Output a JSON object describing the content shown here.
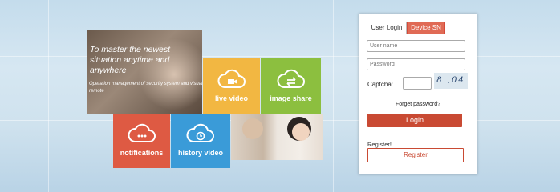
{
  "hero": {
    "title": "To master the newest situation anytime and anywhere",
    "subtitle": "Operation management of security system and visual remote"
  },
  "tiles": [
    {
      "label": "live video",
      "icon": "cloud-video-icon",
      "color": "#f2b742"
    },
    {
      "label": "image share",
      "icon": "cloud-share-icon",
      "color": "#8cbf3f"
    },
    {
      "label": "notifications",
      "icon": "cloud-chat-icon",
      "color": "#de5a43"
    },
    {
      "label": "history video",
      "icon": "cloud-clock-icon",
      "color": "#3a9bd8"
    }
  ],
  "login": {
    "tabs": [
      "User Login",
      "Device SN"
    ],
    "username_placeholder": "User name",
    "password_placeholder": "Password",
    "captcha_label": "Captcha:",
    "captcha_text": "8 ,04",
    "forgot": "Forget password?",
    "login_button": "Login",
    "register_prompt": "Register!",
    "register_button": "Register"
  }
}
